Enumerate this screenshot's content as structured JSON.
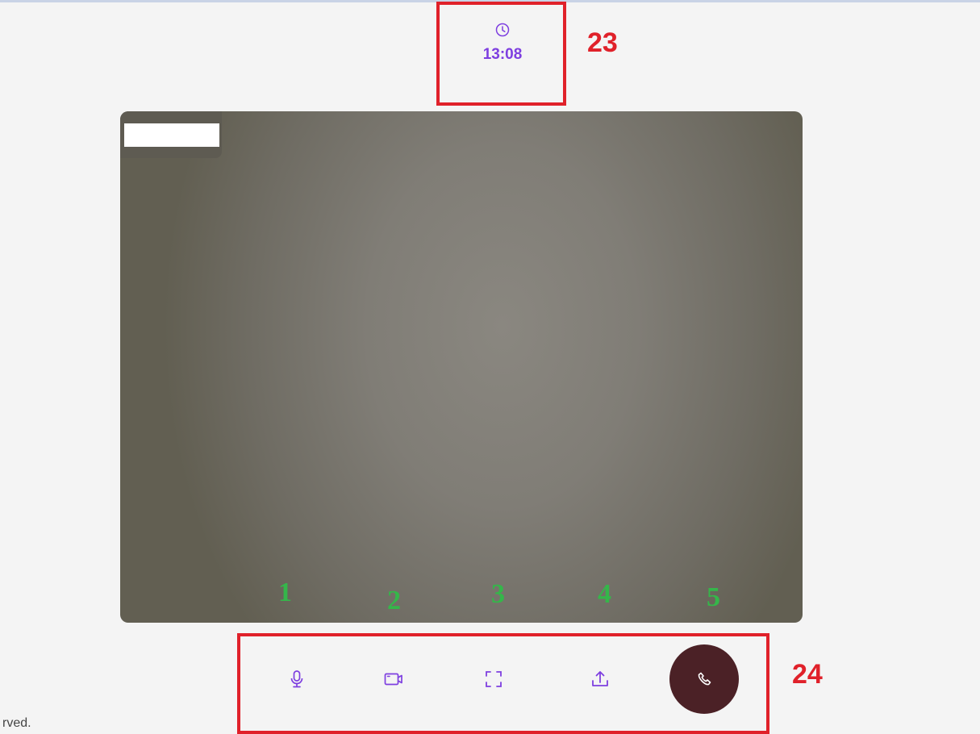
{
  "timer": {
    "time": "13:08",
    "icon": "clock-icon",
    "color": "#7e3fe0"
  },
  "video": {
    "participant_label": ""
  },
  "annotations": {
    "timer_box_number": "23",
    "controls_box_number": "24",
    "control_numbers": [
      "1",
      "2",
      "3",
      "4",
      "5"
    ]
  },
  "controls": [
    {
      "name": "microphone",
      "icon": "microphone-icon"
    },
    {
      "name": "camera",
      "icon": "video-camera-icon"
    },
    {
      "name": "fullscreen",
      "icon": "fullscreen-icon"
    },
    {
      "name": "share-screen",
      "icon": "upload-icon"
    },
    {
      "name": "end-call",
      "icon": "phone-icon",
      "color": "#4b2126"
    }
  ],
  "footer": {
    "text": "rved."
  }
}
